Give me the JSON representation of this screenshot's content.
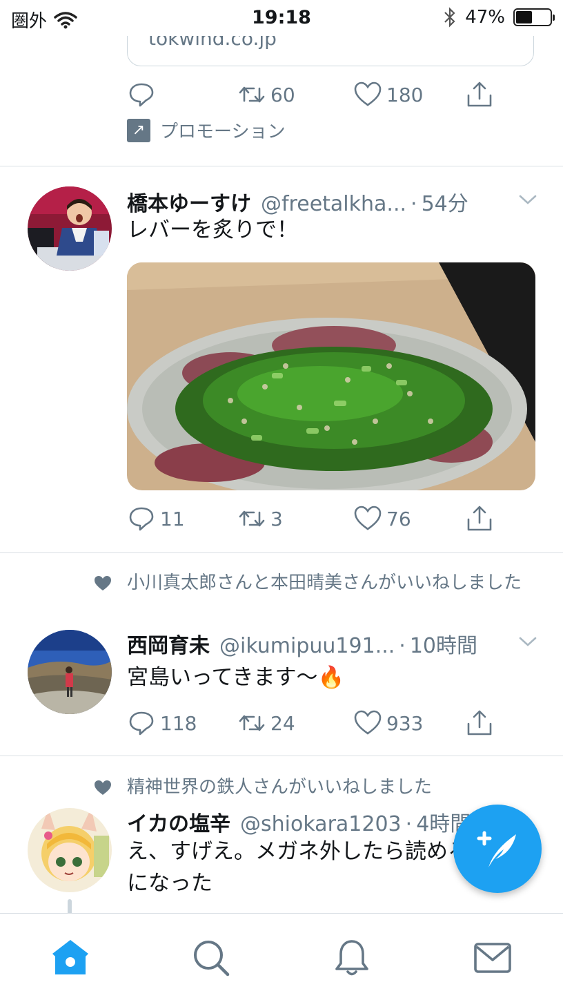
{
  "status_bar": {
    "carrier": "圏外",
    "time": "19:18",
    "battery": "47%",
    "battery_level": 0.47
  },
  "feed": {
    "promo_card": {
      "domain": "tokwind.co.jp"
    },
    "promo_actions": {
      "retweets": "60",
      "likes": "180"
    },
    "promotion_label": "プロモーション",
    "tweets": [
      {
        "name": "橋本ゆーすけ",
        "handle": "@freetalkha...",
        "time": "54分",
        "text": "レバーを炙りで！",
        "replies": "11",
        "retweets": "3",
        "likes": "76"
      },
      {
        "liked_by": "小川真太郎さんと本田晴美さんがいいねしました",
        "name": "西岡育未",
        "handle": "@ikumipuu191...",
        "time": "10時間",
        "text": "宮島いってきます〜🔥",
        "replies": "118",
        "retweets": "24",
        "likes": "933"
      },
      {
        "liked_by": "精神世界の鉄人さんがいいねしました",
        "name": "イカの塩辛",
        "handle": "@shiokara1203",
        "time": "4時間",
        "text": "え、すげえ。メガネ外したら読めるようになった"
      }
    ]
  },
  "colors": {
    "accent": "#1da1f2",
    "secondary_text": "#657786",
    "divider": "#d9dfe4"
  },
  "icons": [
    "wifi-icon",
    "bluetooth-icon",
    "reply-icon",
    "retweet-icon",
    "like-icon",
    "share-icon",
    "promoted-icon",
    "chevron-down-icon",
    "heart-icon",
    "compose-icon",
    "home-icon",
    "search-icon",
    "notifications-icon",
    "messages-icon"
  ]
}
